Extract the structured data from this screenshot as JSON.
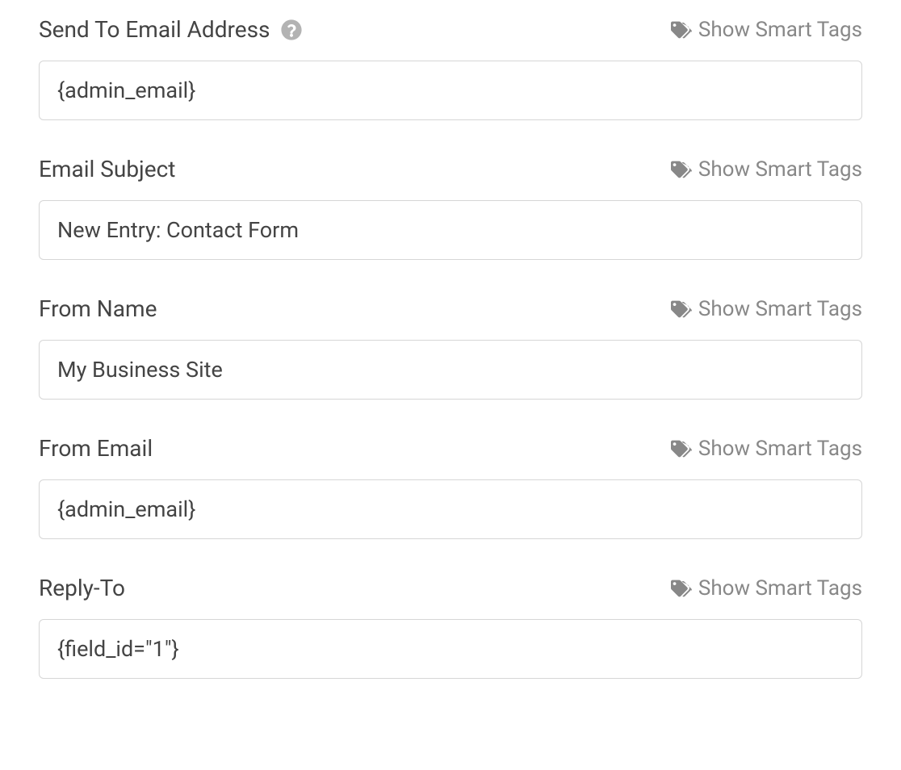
{
  "common": {
    "show_smart_tags_label": "Show Smart Tags"
  },
  "fields": {
    "send_to": {
      "label": "Send To Email Address",
      "value": "{admin_email}",
      "has_help": true
    },
    "email_subject": {
      "label": "Email Subject",
      "value": "New Entry: Contact Form",
      "has_help": false
    },
    "from_name": {
      "label": "From Name",
      "value": "My Business Site",
      "has_help": false
    },
    "from_email": {
      "label": "From Email",
      "value": "{admin_email}",
      "has_help": false
    },
    "reply_to": {
      "label": "Reply-To",
      "value": "{field_id=\"1\"}",
      "has_help": false
    }
  }
}
